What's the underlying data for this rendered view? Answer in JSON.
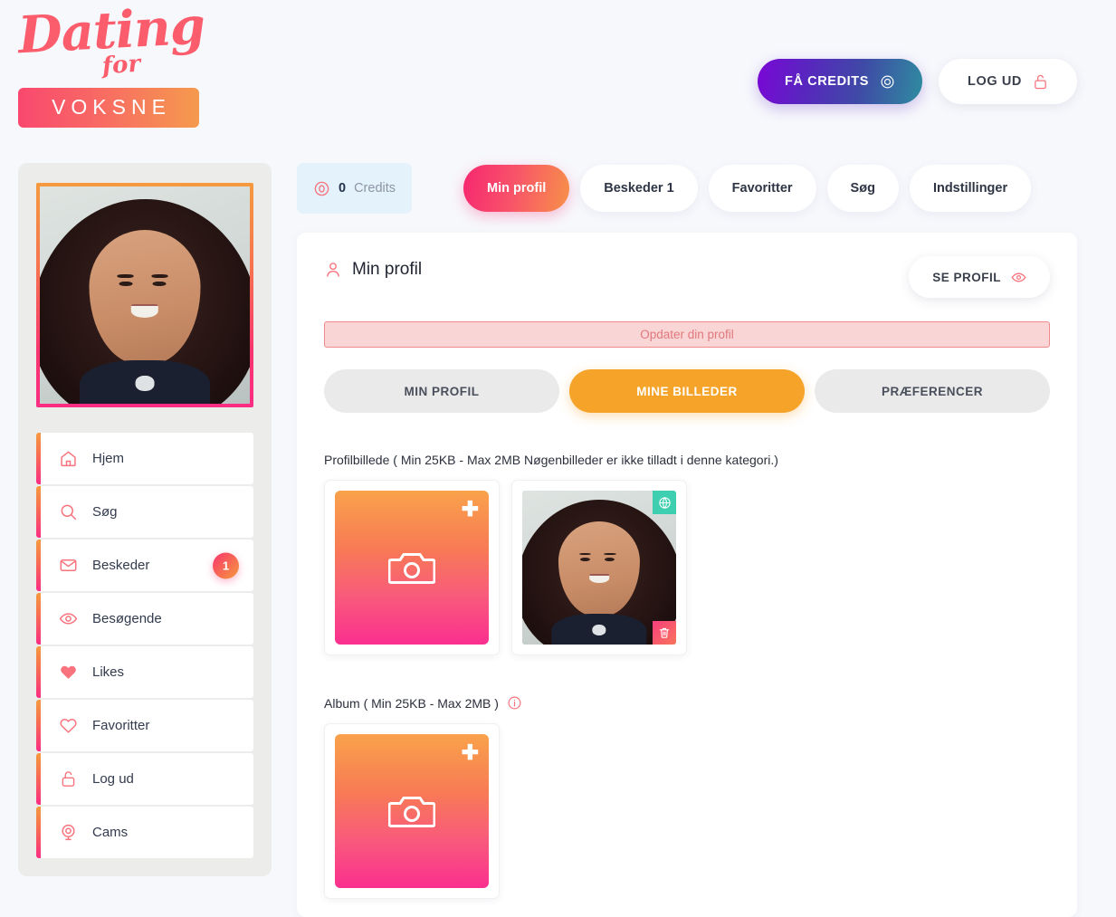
{
  "brand": {
    "script_top": "Dating",
    "script_mid": "for",
    "badge": "VOKSNE"
  },
  "header": {
    "credits_button": "FÅ CREDITS",
    "logout_button": "LOG UD"
  },
  "sidebar": {
    "items": [
      {
        "label": "Hjem",
        "icon": "home-icon",
        "badge": ""
      },
      {
        "label": "Søg",
        "icon": "search-icon",
        "badge": ""
      },
      {
        "label": "Beskeder",
        "icon": "envelope-icon",
        "badge": "1"
      },
      {
        "label": "Besøgende",
        "icon": "eye-icon",
        "badge": ""
      },
      {
        "label": "Likes",
        "icon": "heart-filled-icon",
        "badge": ""
      },
      {
        "label": "Favoritter",
        "icon": "heart-outline-icon",
        "badge": ""
      },
      {
        "label": "Log ud",
        "icon": "unlock-icon",
        "badge": ""
      },
      {
        "label": "Cams",
        "icon": "webcam-icon",
        "badge": ""
      }
    ]
  },
  "topbar": {
    "credits_count": "0",
    "credits_word": "Credits",
    "tabs": [
      {
        "label": "Min profil",
        "active": true
      },
      {
        "label": "Beskeder 1",
        "active": false
      },
      {
        "label": "Favoritter",
        "active": false
      },
      {
        "label": "Søg",
        "active": false
      },
      {
        "label": "Indstillinger",
        "active": false
      }
    ]
  },
  "panel": {
    "title": "Min profil",
    "view_profile_button": "SE PROFIL",
    "alert": "Opdater din profil",
    "subtabs": [
      {
        "label": "MIN PROFIL",
        "active": false
      },
      {
        "label": "MINE BILLEDER",
        "active": true
      },
      {
        "label": "PRÆFERENCER",
        "active": false
      }
    ],
    "profile_section_label": "Profilbillede ( Min 25KB - Max 2MB Nøgenbilleder er ikke tilladt i denne kategori.)",
    "album_section_label": "Album ( Min 25KB - Max 2MB )",
    "plus_glyph": "✚"
  },
  "colors": {
    "accent_pink": "#f6276f",
    "accent_orange": "#f79149",
    "active_tab_orange": "#f6a32a",
    "teal_badge": "#3ecfb0",
    "alert_bg": "#fad5d5",
    "alert_border": "#f08a8a",
    "credits_chip_bg": "#e3f2fb",
    "page_bg": "#f7f8fc",
    "sidebar_bg": "#ececea"
  }
}
